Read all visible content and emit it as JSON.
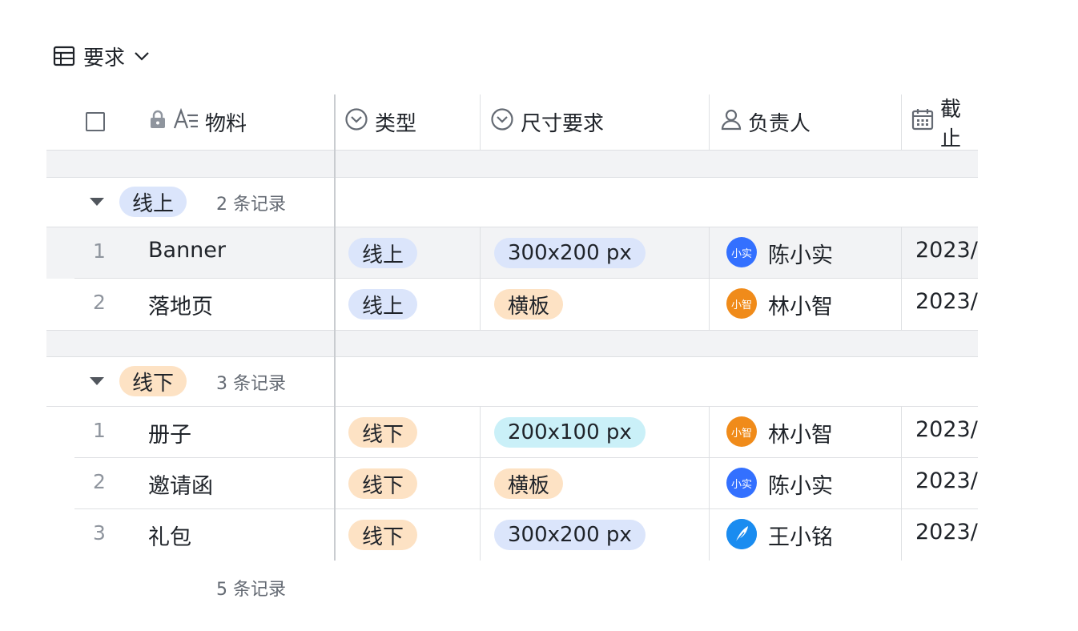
{
  "view": {
    "title": "要求",
    "table_icon": "table-icon",
    "dropdown_icon": "chevron-down-icon"
  },
  "columns": {
    "material": {
      "label": "物料",
      "icons": [
        "lock-icon",
        "text-field-icon"
      ]
    },
    "type": {
      "label": "类型",
      "icon": "single-select-icon"
    },
    "size": {
      "label": "尺寸要求",
      "icon": "single-select-icon"
    },
    "owner": {
      "label": "负责人",
      "icon": "person-icon"
    },
    "deadline": {
      "label": "截止",
      "icon": "calendar-icon"
    }
  },
  "groups": [
    {
      "label": "线上",
      "count": "2 条记录",
      "color": "#dbe5fb",
      "rows": [
        {
          "num": "1",
          "material": "Banner",
          "type": "线上",
          "type_color": "#dbe5fb",
          "size": "300x200 px",
          "size_color": "#dbe5fb",
          "owner": "陈小实",
          "avatar_text": "小实",
          "avatar_color": "#3370ff",
          "deadline": "2023/"
        },
        {
          "num": "2",
          "material": "落地页",
          "type": "线上",
          "type_color": "#dbe5fb",
          "size": "横板",
          "size_color": "#fde2c4",
          "owner": "林小智",
          "avatar_text": "小智",
          "avatar_color": "#f08b1a",
          "deadline": "2023/"
        }
      ]
    },
    {
      "label": "线下",
      "count": "3 条记录",
      "color": "#fde2c4",
      "rows": [
        {
          "num": "1",
          "material": "册子",
          "type": "线下",
          "type_color": "#fde2c4",
          "size": "200x100 px",
          "size_color": "#caf0f8",
          "owner": "林小智",
          "avatar_text": "小智",
          "avatar_color": "#f08b1a",
          "deadline": "2023/"
        },
        {
          "num": "2",
          "material": "邀请函",
          "type": "线下",
          "type_color": "#fde2c4",
          "size": "横板",
          "size_color": "#fde2c4",
          "owner": "陈小实",
          "avatar_text": "小实",
          "avatar_color": "#3370ff",
          "deadline": "2023/"
        },
        {
          "num": "3",
          "material": "礼包",
          "type": "线下",
          "type_color": "#fde2c4",
          "size": "300x200 px",
          "size_color": "#dbe5fb",
          "owner": "王小铭",
          "avatar_text": "",
          "avatar_color": "#1e88e5",
          "deadline": "2023/"
        }
      ]
    }
  ],
  "footer": {
    "count": "5 条记录"
  }
}
